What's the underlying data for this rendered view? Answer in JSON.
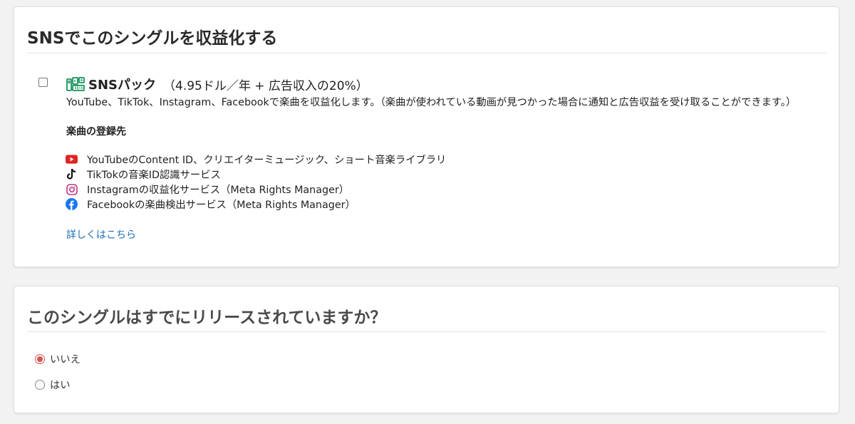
{
  "monetize_section": {
    "title": "SNSでこのシングルを収益化する",
    "sns_pack": {
      "checked": false,
      "icon": "sns-pack-icon",
      "name": "SNSパック",
      "price": "（4.95ドル／年 + 広告収入の20%）",
      "description": "YouTube、TikTok、Instagram、Facebookで楽曲を収益化します。（楽曲が使われている動画が見つかった場合に通知と広告収益を受け取ることができます。）",
      "registration_heading": "楽曲の登録先",
      "services": [
        {
          "icon": "youtube-icon",
          "label": "YouTubeのContent ID、クリエイターミュージック、ショート音楽ライブラリ"
        },
        {
          "icon": "tiktok-icon",
          "label": "TikTokの音楽ID認識サービス"
        },
        {
          "icon": "instagram-icon",
          "label": "Instagramの収益化サービス（Meta Rights Manager）"
        },
        {
          "icon": "facebook-icon",
          "label": "Facebookの楽曲検出サービス（Meta Rights Manager）"
        }
      ],
      "more_link": "詳しくはこちら"
    }
  },
  "release_section": {
    "title": "このシングルはすでにリリースされていますか？",
    "options": [
      {
        "label": "いいえ",
        "selected": true
      },
      {
        "label": "はい",
        "selected": false
      }
    ]
  },
  "colors": {
    "accent_red": "#d9534f",
    "link_blue": "#1f6fb5",
    "sns_green": "#2e9e6b"
  }
}
